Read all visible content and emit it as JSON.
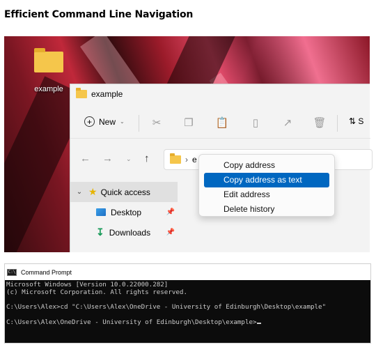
{
  "title": "Efficient Command Line Navigation",
  "desktop": {
    "folder_label": "example"
  },
  "explorer": {
    "window_title": "example",
    "toolbar": {
      "new_label": "New",
      "sort_label": "S"
    },
    "address": {
      "path_fragment": "e"
    },
    "sidebar": [
      {
        "label": "Quick access",
        "icon": "star-icon"
      },
      {
        "label": "Desktop",
        "icon": "desktop-icon",
        "pinned": true
      },
      {
        "label": "Downloads",
        "icon": "download-icon",
        "pinned": true
      }
    ]
  },
  "context_menu": {
    "items": [
      "Copy address",
      "Copy address as text",
      "Edit address",
      "Delete history"
    ],
    "selected": "Copy address as text"
  },
  "cmd": {
    "title": "Command Prompt",
    "icon_text": "C:\\",
    "lines": [
      "Microsoft Windows [Version 10.0.22000.282]",
      "(c) Microsoft Corporation. All rights reserved.",
      "",
      "C:\\Users\\Alex>cd \"C:\\Users\\Alex\\OneDrive - University of Edinburgh\\Desktop\\example\"",
      "",
      "C:\\Users\\Alex\\OneDrive - University of Edinburgh\\Desktop\\example>"
    ]
  },
  "colors": {
    "accent": "#0067c0",
    "folder": "#f5c64b",
    "terminal_bg": "#0c0c0c"
  }
}
